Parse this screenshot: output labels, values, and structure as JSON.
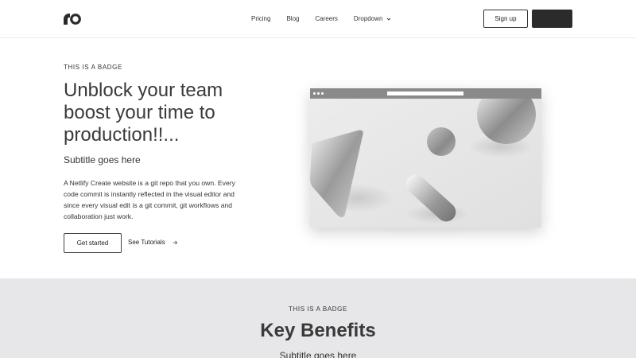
{
  "header": {
    "logo_icon": "brand-logo-icon",
    "nav": [
      {
        "label": "Pricing"
      },
      {
        "label": "Blog"
      },
      {
        "label": "Careers"
      },
      {
        "label": "Dropdown",
        "icon": "chevron-down-icon"
      }
    ],
    "signup_label": "Sign up",
    "dark_button_label": ""
  },
  "hero": {
    "badge": "THIS IS A BADGE",
    "title": "Unblock your team boost your time to production!!...",
    "subtitle": "Subtitle goes here",
    "description": "A Netlify Create website is a git repo that you own. Every code commit is instantly reflected in the visual editor and since every visual edit is a git commit, git workflows and collaboration just work.",
    "primary_button": "Get started",
    "secondary_link": "See Tutorials",
    "secondary_icon": "arrow-right-icon"
  },
  "mockup": {
    "icon": "browser-window-illustration"
  },
  "benefits": {
    "badge": "THIS IS A BADGE",
    "title": "Key Benefits",
    "subtitle": "Subtitle goes here"
  },
  "colors": {
    "dark_button": "#2b2b2b",
    "section_bg": "#e7e7e9",
    "text": "#333333"
  }
}
